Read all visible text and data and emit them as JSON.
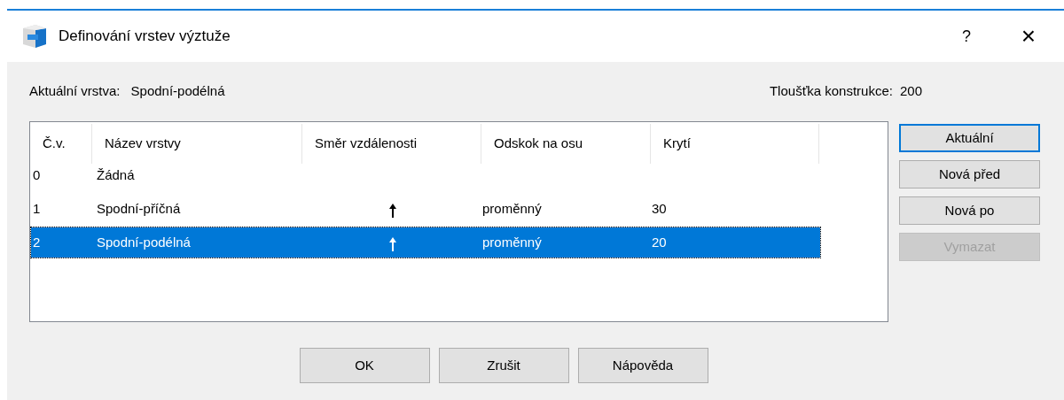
{
  "window": {
    "title": "Definování vrstev výztuže",
    "help": "?",
    "close": "×"
  },
  "current_layer": {
    "label": "Aktuální vrstva:",
    "value": "Spodní-podélná"
  },
  "thickness": {
    "label": "Tloušťka konstrukce:",
    "value": "200"
  },
  "table": {
    "columns": [
      "Č.v.",
      "Název vrstvy",
      "Směr vzdálenosti",
      "Odskok na osu",
      "Krytí"
    ],
    "rows": [
      {
        "number": "0",
        "name": "Žádná",
        "kind": "plain",
        "selected": false
      },
      {
        "number": "1",
        "name": "Spodní-příčná",
        "kind": "arrow",
        "offset": "proměnný",
        "cover": "30",
        "selected": false
      },
      {
        "number": "2",
        "name": "Spodní-podélná",
        "kind": "arrow",
        "offset": "proměnný",
        "cover": "20",
        "selected": true
      }
    ]
  },
  "side_buttons": [
    {
      "label": "Aktuální",
      "default": true,
      "disabled": false
    },
    {
      "label": "Nová před",
      "default": false,
      "disabled": false
    },
    {
      "label": "Nová po",
      "default": false,
      "disabled": false
    },
    {
      "label": "Vymazat",
      "default": false,
      "disabled": true
    }
  ],
  "buttons": [
    "OK",
    "Zrušit",
    "Nápověda"
  ]
}
